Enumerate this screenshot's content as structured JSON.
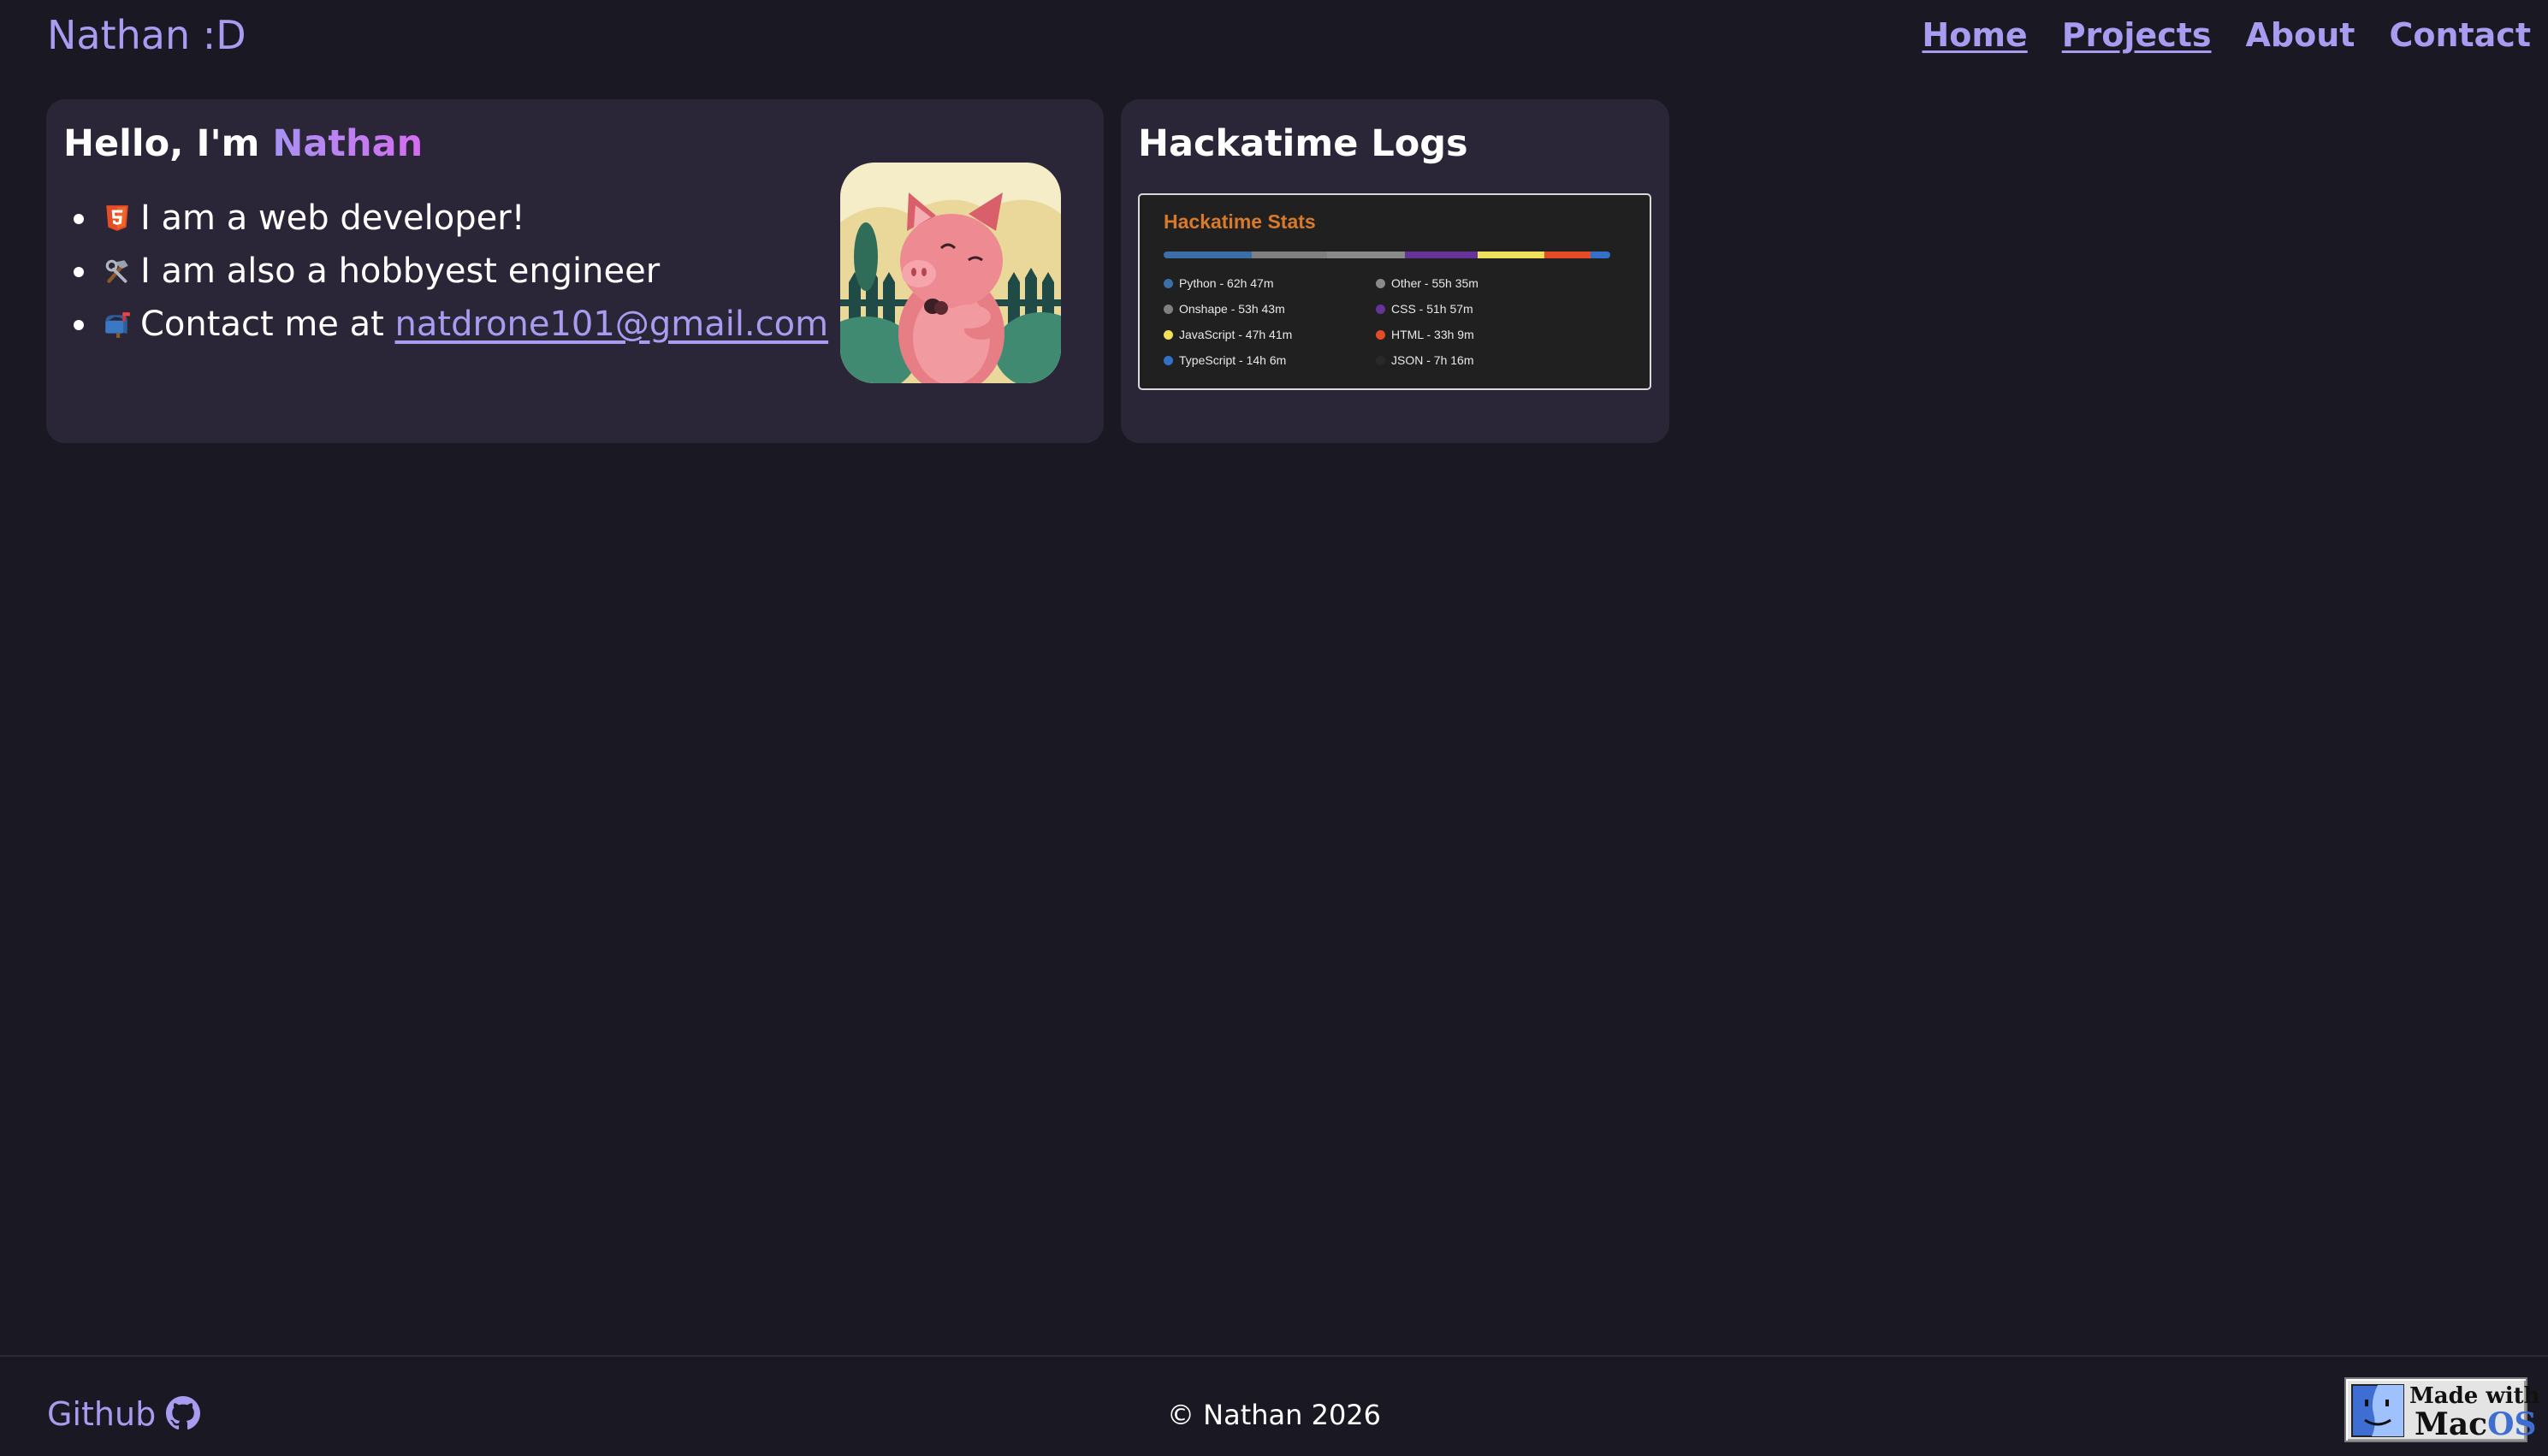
{
  "header": {
    "brand": "Nathan :D",
    "nav": [
      {
        "label": "Home",
        "underlined": true
      },
      {
        "label": "Projects",
        "underlined": true
      },
      {
        "label": "About",
        "underlined": false
      },
      {
        "label": "Contact",
        "underlined": false
      }
    ]
  },
  "intro": {
    "greeting": "Hello, I'm ",
    "name": "Nathan",
    "items": [
      {
        "icon": "html5-icon",
        "text": "I am a web developer!"
      },
      {
        "icon": "hammer-wrench-icon",
        "text": "I am also a hobbyest engineer"
      },
      {
        "icon": "mailbox-icon",
        "text": "Contact me at ",
        "link": "natdrone101@gmail.com"
      }
    ],
    "avatar": "pig-avatar"
  },
  "hackatime": {
    "heading": "Hackatime Logs",
    "panel_title": "Hackatime Stats",
    "languages": [
      {
        "name": "Python",
        "time": "62h 47m",
        "label": "Python - 62h 47m",
        "color": "#3c6ea8"
      },
      {
        "name": "Onshape",
        "time": "53h 43m",
        "label": "Onshape - 53h 43m",
        "color": "#808080"
      },
      {
        "name": "JavaScript",
        "time": "47h 41m",
        "label": "JavaScript - 47h 41m",
        "color": "#f0e05a"
      },
      {
        "name": "TypeScript",
        "time": "14h 6m",
        "label": "TypeScript - 14h 6m",
        "color": "#3570c8"
      },
      {
        "name": "Other",
        "time": "55h 35m",
        "label": "Other - 55h 35m",
        "color": "#8a8a8a"
      },
      {
        "name": "CSS",
        "time": "51h 57m",
        "label": "CSS - 51h 57m",
        "color": "#663399"
      },
      {
        "name": "HTML",
        "time": "33h 9m",
        "label": "HTML - 33h 9m",
        "color": "#e34c26"
      },
      {
        "name": "JSON",
        "time": "7h 16m",
        "label": "JSON - 7h 16m",
        "color": "#292929"
      }
    ],
    "bar_order": [
      "Python",
      "Onshape",
      "Other",
      "CSS",
      "JavaScript",
      "HTML",
      "TypeScript"
    ],
    "bar_minutes": {
      "Python": 3767,
      "Onshape": 3223,
      "Other": 3335,
      "CSS": 3117,
      "JavaScript": 2861,
      "HTML": 1989,
      "TypeScript": 846
    }
  },
  "footer": {
    "github_label": "Github",
    "copyright": "© Nathan 2026",
    "badge": {
      "line1": "Made with",
      "mac": "Mac",
      "os": "OS"
    }
  },
  "colors": {
    "background": "#1a1822",
    "card": "#2a2638",
    "accent": "#a79cf0",
    "stats_title": "#d97a2b"
  }
}
